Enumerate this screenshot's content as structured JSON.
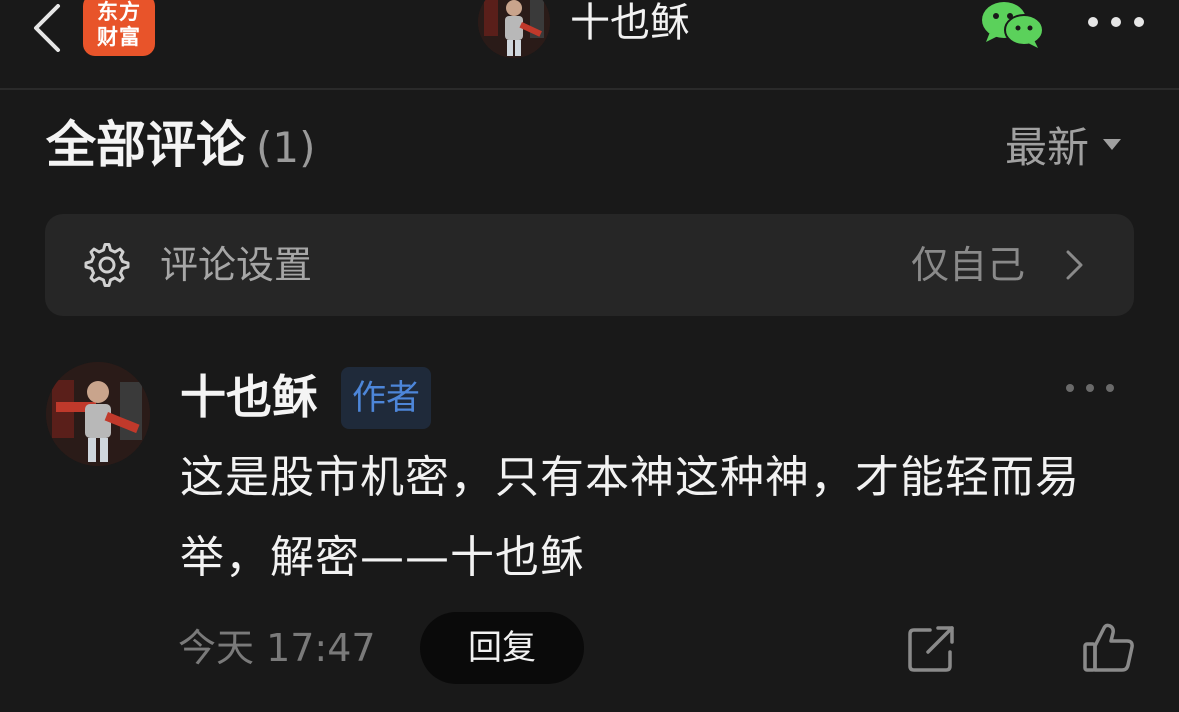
{
  "header": {
    "app_logo_line1": "东方",
    "app_logo_line2": "财富",
    "title": "十也稣"
  },
  "comments": {
    "heading": "全部评论",
    "count": "(1)",
    "sort_label": "最新"
  },
  "settings": {
    "label": "评论设置",
    "value": "仅自己"
  },
  "comment": {
    "author": "十也稣",
    "badge": "作者",
    "text": "这是股市机密，只有本神这种神，才能轻而易举，解密——十也稣",
    "time": "今天 17:47",
    "reply_label": "回复"
  },
  "colors": {
    "background": "#191919",
    "card": "#262626",
    "logo_orange": "#e8542a",
    "badge_blue": "#4d86d9",
    "wechat_green": "#5bd15b"
  },
  "icons": [
    "back-arrow-icon",
    "wechat-icon",
    "more-dots-icon",
    "gear-icon",
    "chevron-right-icon",
    "share-icon",
    "thumbs-up-icon"
  ]
}
